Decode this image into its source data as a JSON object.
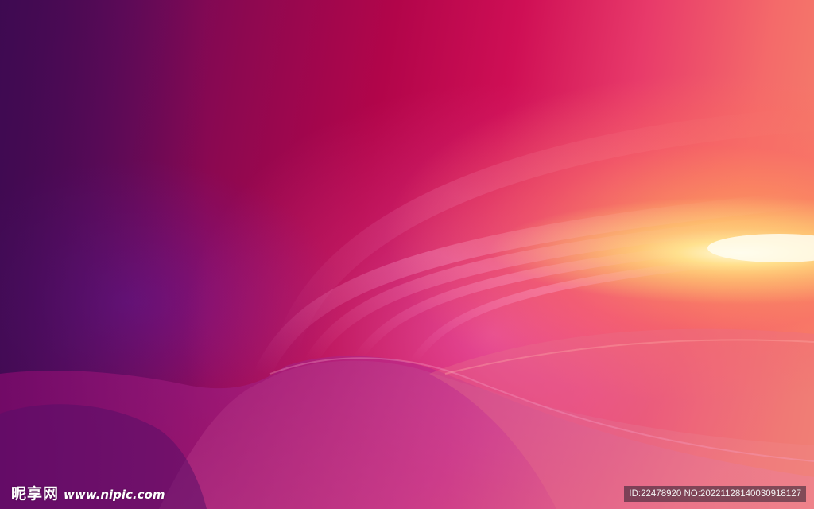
{
  "image": {
    "description_colors": {
      "deep_purple": "#4b0a55",
      "magenta": "#b2054a",
      "crimson": "#cf0f55",
      "pink": "#f062a8",
      "orange": "#f58a6a",
      "glow_yellow": "#fff4c8"
    }
  },
  "watermark": {
    "logo_text": "昵享网",
    "url": "www.nipic.com",
    "id_text": "ID:22478920 NO:20221128140030918127"
  }
}
